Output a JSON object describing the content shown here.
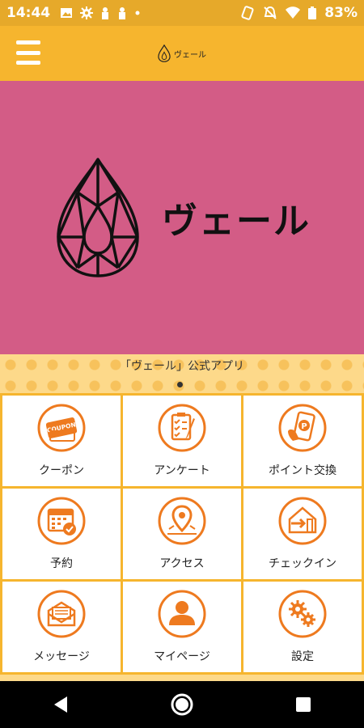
{
  "status_bar": {
    "time": "14:44",
    "battery": "83%",
    "left_icons": [
      "image-icon",
      "gear-icon",
      "figure-icon",
      "figure2-icon",
      "dot-icon"
    ],
    "right_icons": [
      "sync-icon",
      "notifications-off-icon",
      "wifi-icon",
      "battery-icon"
    ]
  },
  "header": {
    "logo_text": "ヴェール",
    "menu_icon": "hamburger-icon"
  },
  "hero": {
    "brand_name": "ヴェール",
    "background": "#d35c86"
  },
  "subtitle": "「ヴェール」公式アプリ",
  "menu": [
    {
      "label": "クーポン",
      "icon": "coupon-icon"
    },
    {
      "label": "アンケート",
      "icon": "survey-icon"
    },
    {
      "label": "ポイント交換",
      "icon": "point-exchange-icon"
    },
    {
      "label": "予約",
      "icon": "calendar-icon"
    },
    {
      "label": "アクセス",
      "icon": "map-pin-icon"
    },
    {
      "label": "チェックイン",
      "icon": "checkin-icon"
    },
    {
      "label": "メッセージ",
      "icon": "message-icon"
    },
    {
      "label": "マイページ",
      "icon": "user-icon"
    },
    {
      "label": "設定",
      "icon": "settings-icon"
    }
  ],
  "colors": {
    "accent": "#f6b52e",
    "icon_orange": "#ee7a1f",
    "hero_pink": "#d35c86"
  },
  "nav": [
    "back-icon",
    "home-icon",
    "recents-icon"
  ]
}
